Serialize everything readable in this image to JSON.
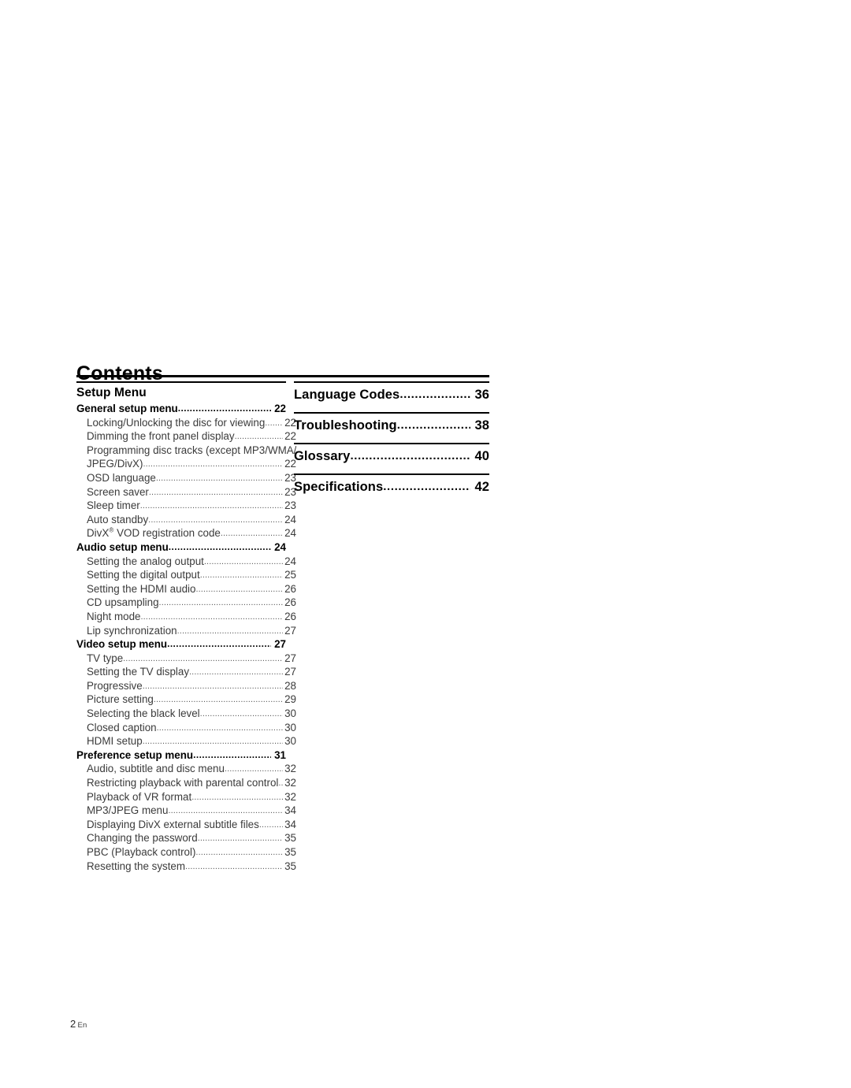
{
  "page": {
    "title": "Contents",
    "footer_page_number": "2",
    "footer_language": "En"
  },
  "left_column": {
    "section_title": "Setup Menu",
    "entries": [
      {
        "level": 1,
        "label": "General setup menu",
        "page": "22"
      },
      {
        "level": 2,
        "label": "Locking/Unlocking the disc for viewing",
        "page": "22"
      },
      {
        "level": 2,
        "label": "Dimming the front panel display",
        "page": "22"
      },
      {
        "level": 2,
        "label": "Programming disc tracks (except MP3/WMA/",
        "page": "",
        "continuation": true
      },
      {
        "level": 2,
        "label": "JPEG/DivX)",
        "page": "22"
      },
      {
        "level": 2,
        "label": "OSD language",
        "page": "23"
      },
      {
        "level": 2,
        "label": "Screen saver",
        "page": "23"
      },
      {
        "level": 2,
        "label": "Sleep timer",
        "page": "23"
      },
      {
        "level": 2,
        "label": "Auto standby",
        "page": "24"
      },
      {
        "level": 2,
        "label": "DivX® VOD registration code",
        "page": "24",
        "has_reg_mark": true
      },
      {
        "level": 1,
        "label": "Audio setup menu",
        "page": "24"
      },
      {
        "level": 2,
        "label": "Setting the analog output",
        "page": "24"
      },
      {
        "level": 2,
        "label": "Setting the digital output",
        "page": "25"
      },
      {
        "level": 2,
        "label": "Setting the HDMI audio",
        "page": "26"
      },
      {
        "level": 2,
        "label": "CD upsampling",
        "page": "26"
      },
      {
        "level": 2,
        "label": "Night mode",
        "page": "26"
      },
      {
        "level": 2,
        "label": "Lip synchronization",
        "page": "27"
      },
      {
        "level": 1,
        "label": "Video setup menu",
        "page": "27"
      },
      {
        "level": 2,
        "label": "TV type",
        "page": "27"
      },
      {
        "level": 2,
        "label": "Setting the TV display",
        "page": "27"
      },
      {
        "level": 2,
        "label": "Progressive",
        "page": "28"
      },
      {
        "level": 2,
        "label": "Picture setting",
        "page": "29"
      },
      {
        "level": 2,
        "label": "Selecting the black level",
        "page": "30"
      },
      {
        "level": 2,
        "label": "Closed caption",
        "page": "30"
      },
      {
        "level": 2,
        "label": "HDMI setup",
        "page": "30"
      },
      {
        "level": 1,
        "label": "Preference setup menu",
        "page": "31"
      },
      {
        "level": 2,
        "label": "Audio, subtitle and disc menu",
        "page": "32"
      },
      {
        "level": 2,
        "label": "Restricting playback with parental control",
        "page": "32"
      },
      {
        "level": 2,
        "label": "Playback of VR format",
        "page": "32"
      },
      {
        "level": 2,
        "label": "MP3/JPEG menu",
        "page": "34"
      },
      {
        "level": 2,
        "label": "Displaying DivX external subtitle files",
        "page": "34"
      },
      {
        "level": 2,
        "label": "Changing the password",
        "page": "35"
      },
      {
        "level": 2,
        "label": "PBC (Playback control)",
        "page": "35"
      },
      {
        "level": 2,
        "label": "Resetting the system",
        "page": "35"
      }
    ]
  },
  "right_column": {
    "entries": [
      {
        "label": "Language Codes",
        "page": "36"
      },
      {
        "label": "Troubleshooting ",
        "page": "38"
      },
      {
        "label": "Glossary ",
        "page": "40"
      },
      {
        "label": "Specifications ",
        "page": "42"
      }
    ]
  },
  "dot_leader_char": "."
}
